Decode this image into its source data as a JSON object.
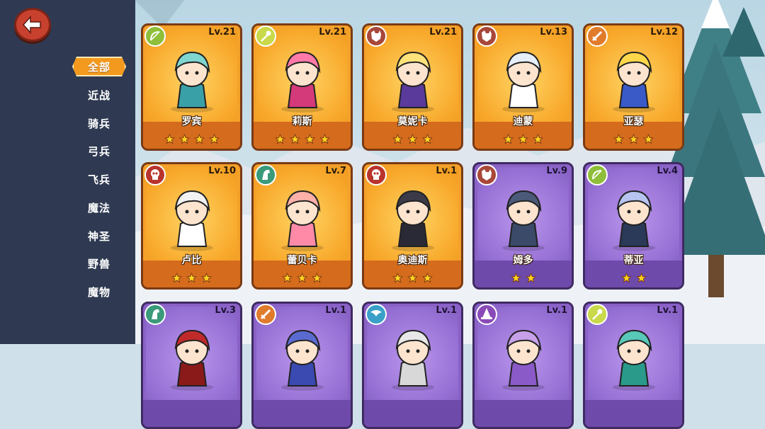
{
  "sidebar": {
    "back_icon": "back-arrow-icon",
    "filters": [
      {
        "label": "全部",
        "active": true
      },
      {
        "label": "近战",
        "active": false
      },
      {
        "label": "骑兵",
        "active": false
      },
      {
        "label": "弓兵",
        "active": false
      },
      {
        "label": "飞兵",
        "active": false
      },
      {
        "label": "魔法",
        "active": false
      },
      {
        "label": "神圣",
        "active": false
      },
      {
        "label": "野兽",
        "active": false
      },
      {
        "label": "魔物",
        "active": false
      }
    ]
  },
  "colors": {
    "accent": "#f39a1e",
    "sidebar": "#2f3a52",
    "gold_card": "#f4a12a",
    "purple_card": "#8a61c6"
  },
  "heroes": [
    {
      "name": "罗宾",
      "level": "Lv.21",
      "stars": 4,
      "rarity": "gold",
      "class_icon": "bow-icon",
      "class_color": "#8fbf3a"
    },
    {
      "name": "莉斯",
      "level": "Lv.21",
      "stars": 4,
      "rarity": "gold",
      "class_icon": "staff-icon",
      "class_color": "#c9d94a"
    },
    {
      "name": "莫妮卡",
      "level": "Lv.21",
      "stars": 3,
      "rarity": "gold",
      "class_icon": "wolf-icon",
      "class_color": "#a8483a"
    },
    {
      "name": "迪蒙",
      "level": "Lv.13",
      "stars": 3,
      "rarity": "gold",
      "class_icon": "wolf-icon",
      "class_color": "#a8483a"
    },
    {
      "name": "亚瑟",
      "level": "Lv.12",
      "stars": 3,
      "rarity": "gold",
      "class_icon": "sword-icon",
      "class_color": "#e07b2c"
    },
    {
      "name": "卢比",
      "level": "Lv.10",
      "stars": 3,
      "rarity": "gold",
      "class_icon": "skull-icon",
      "class_color": "#b8342c"
    },
    {
      "name": "蕾贝卡",
      "level": "Lv.7",
      "stars": 3,
      "rarity": "gold",
      "class_icon": "horse-icon",
      "class_color": "#3a9a7a"
    },
    {
      "name": "奥迪斯",
      "level": "Lv.1",
      "stars": 3,
      "rarity": "gold",
      "class_icon": "skull-icon",
      "class_color": "#b8342c"
    },
    {
      "name": "姆多",
      "level": "Lv.9",
      "stars": 2,
      "rarity": "purple",
      "class_icon": "wolf-icon",
      "class_color": "#a8483a"
    },
    {
      "name": "蒂亚",
      "level": "Lv.4",
      "stars": 2,
      "rarity": "purple",
      "class_icon": "bow-icon",
      "class_color": "#8fbf3a"
    },
    {
      "name": "",
      "level": "Lv.3",
      "stars": 0,
      "rarity": "purple",
      "class_icon": "horse-icon",
      "class_color": "#3a9a7a"
    },
    {
      "name": "",
      "level": "Lv.1",
      "stars": 0,
      "rarity": "purple",
      "class_icon": "sword-icon",
      "class_color": "#e07b2c"
    },
    {
      "name": "",
      "level": "Lv.1",
      "stars": 0,
      "rarity": "purple",
      "class_icon": "wing-icon",
      "class_color": "#3aa0c8"
    },
    {
      "name": "",
      "level": "Lv.1",
      "stars": 0,
      "rarity": "purple",
      "class_icon": "wizard-hat-icon",
      "class_color": "#8a4ab8"
    },
    {
      "name": "",
      "level": "Lv.1",
      "stars": 0,
      "rarity": "purple",
      "class_icon": "staff-icon",
      "class_color": "#c9d94a"
    }
  ]
}
